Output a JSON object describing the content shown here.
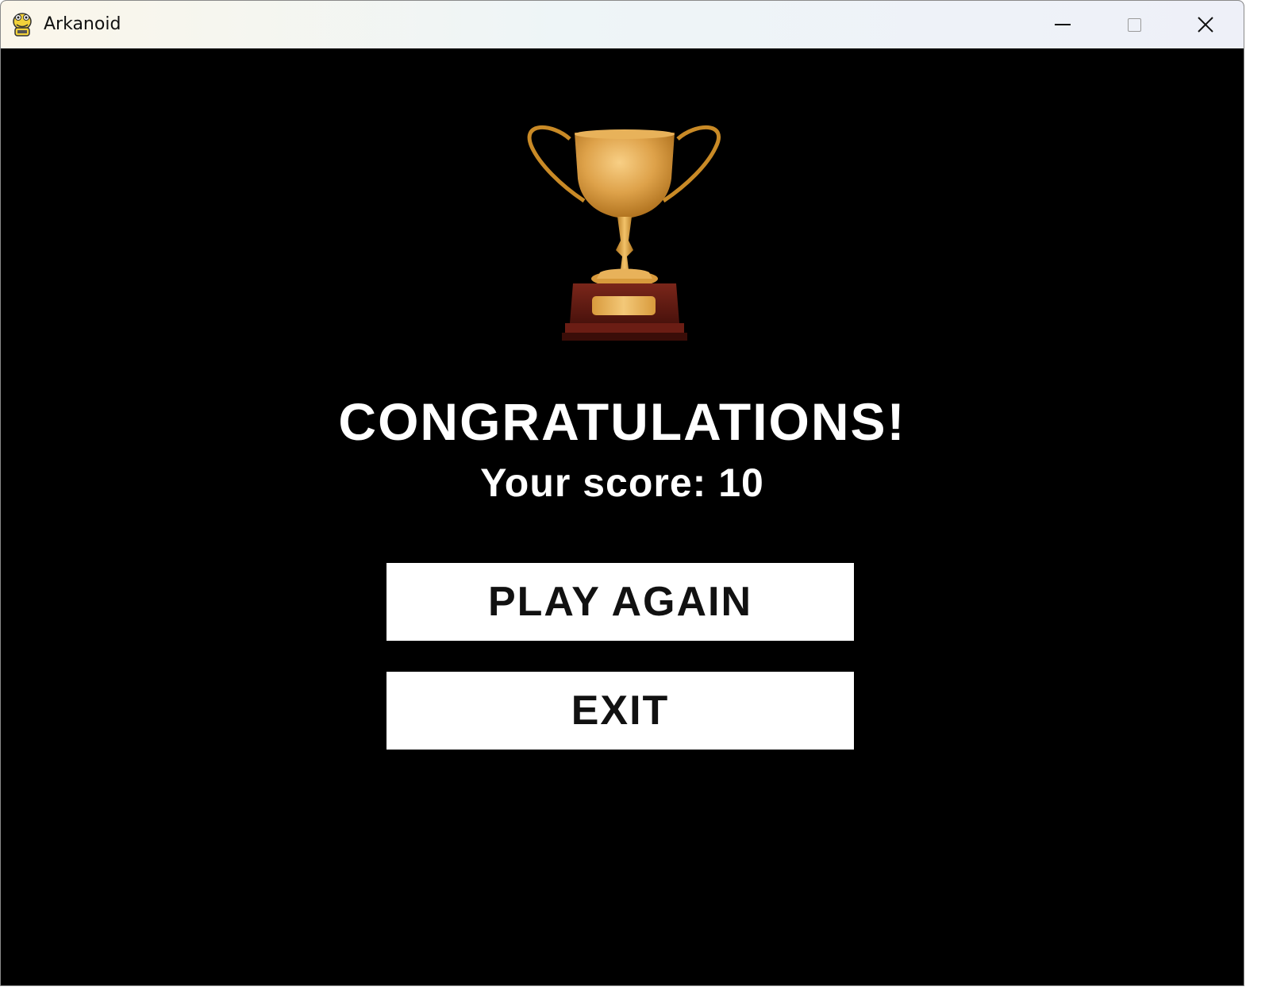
{
  "window": {
    "title": "Arkanoid",
    "app_icon": "pygame-snake-icon",
    "controls": {
      "minimize_icon": "minimize-icon",
      "maximize_icon": "maximize-icon",
      "close_icon": "close-icon"
    }
  },
  "game": {
    "trophy_icon": "trophy-icon",
    "heading": "CONGRATULATIONS!",
    "score_text": "Your score: 10",
    "buttons": {
      "play_again": "PLAY AGAIN",
      "exit": "EXIT"
    }
  },
  "colors": {
    "background": "#000000",
    "text": "#ffffff",
    "button_bg": "#ffffff",
    "button_text": "#111111",
    "trophy_gold": "#d99a2b",
    "trophy_base": "#6b1d14"
  }
}
